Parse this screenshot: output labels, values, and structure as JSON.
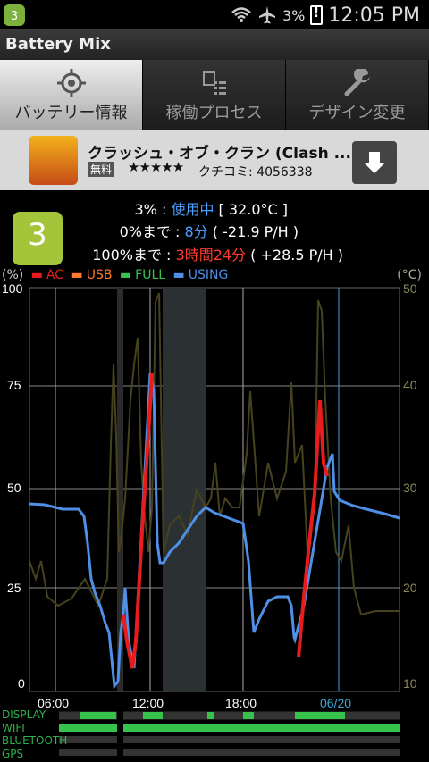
{
  "statusbar": {
    "time": "12:05 PM",
    "battery": "3%",
    "app_badge": "3"
  },
  "title": "Battery Mix",
  "tabs": [
    {
      "label": "バッテリー情報",
      "active": true,
      "icon": "target-icon"
    },
    {
      "label": "稼働プロセス",
      "active": false,
      "icon": "process-list-icon"
    },
    {
      "label": "デザイン変更",
      "active": false,
      "icon": "wrench-icon"
    }
  ],
  "ad": {
    "title": "クラッシュ・オブ・クラン (Clash ...",
    "free": "無料",
    "stars": "★★★★★",
    "reviews": "クチコミ: 4056338",
    "download_icon": "download-icon"
  },
  "info": {
    "level": "3",
    "line1_prefix": "3% : ",
    "line1_status": "使用中",
    "line1_temp": " [ 32.0°C ]",
    "line2_prefix": "0%まで : ",
    "line2_time": "8分",
    "line2_rate": " ( -21.9 P/H )",
    "line3_prefix": "100%まで : ",
    "line3_time": "3時間24分",
    "line3_rate": " ( +28.5 P/H )"
  },
  "legend": {
    "pct": "(%)",
    "ac": "AC",
    "usb": "USB",
    "full": "FULL",
    "using": "USING",
    "celsius": "(°C)"
  },
  "chart_data": {
    "type": "line",
    "x_ticks": [
      "06:00",
      "12:00",
      "18:00",
      "06/20"
    ],
    "y_left_ticks": [
      "100",
      "75",
      "50",
      "25",
      "0"
    ],
    "y_right_ticks": [
      "50",
      "40",
      "30",
      "20",
      "10"
    ],
    "ylim": [
      0,
      100
    ],
    "y2lim": [
      10,
      50
    ],
    "series": [
      {
        "name": "USING",
        "color": "#4f8fe6"
      },
      {
        "name": "AC",
        "color": "#e81c1c"
      }
    ]
  },
  "bottom_rows": [
    "DISPLAY",
    "WIFI",
    "BLUETOOTH",
    "GPS"
  ]
}
